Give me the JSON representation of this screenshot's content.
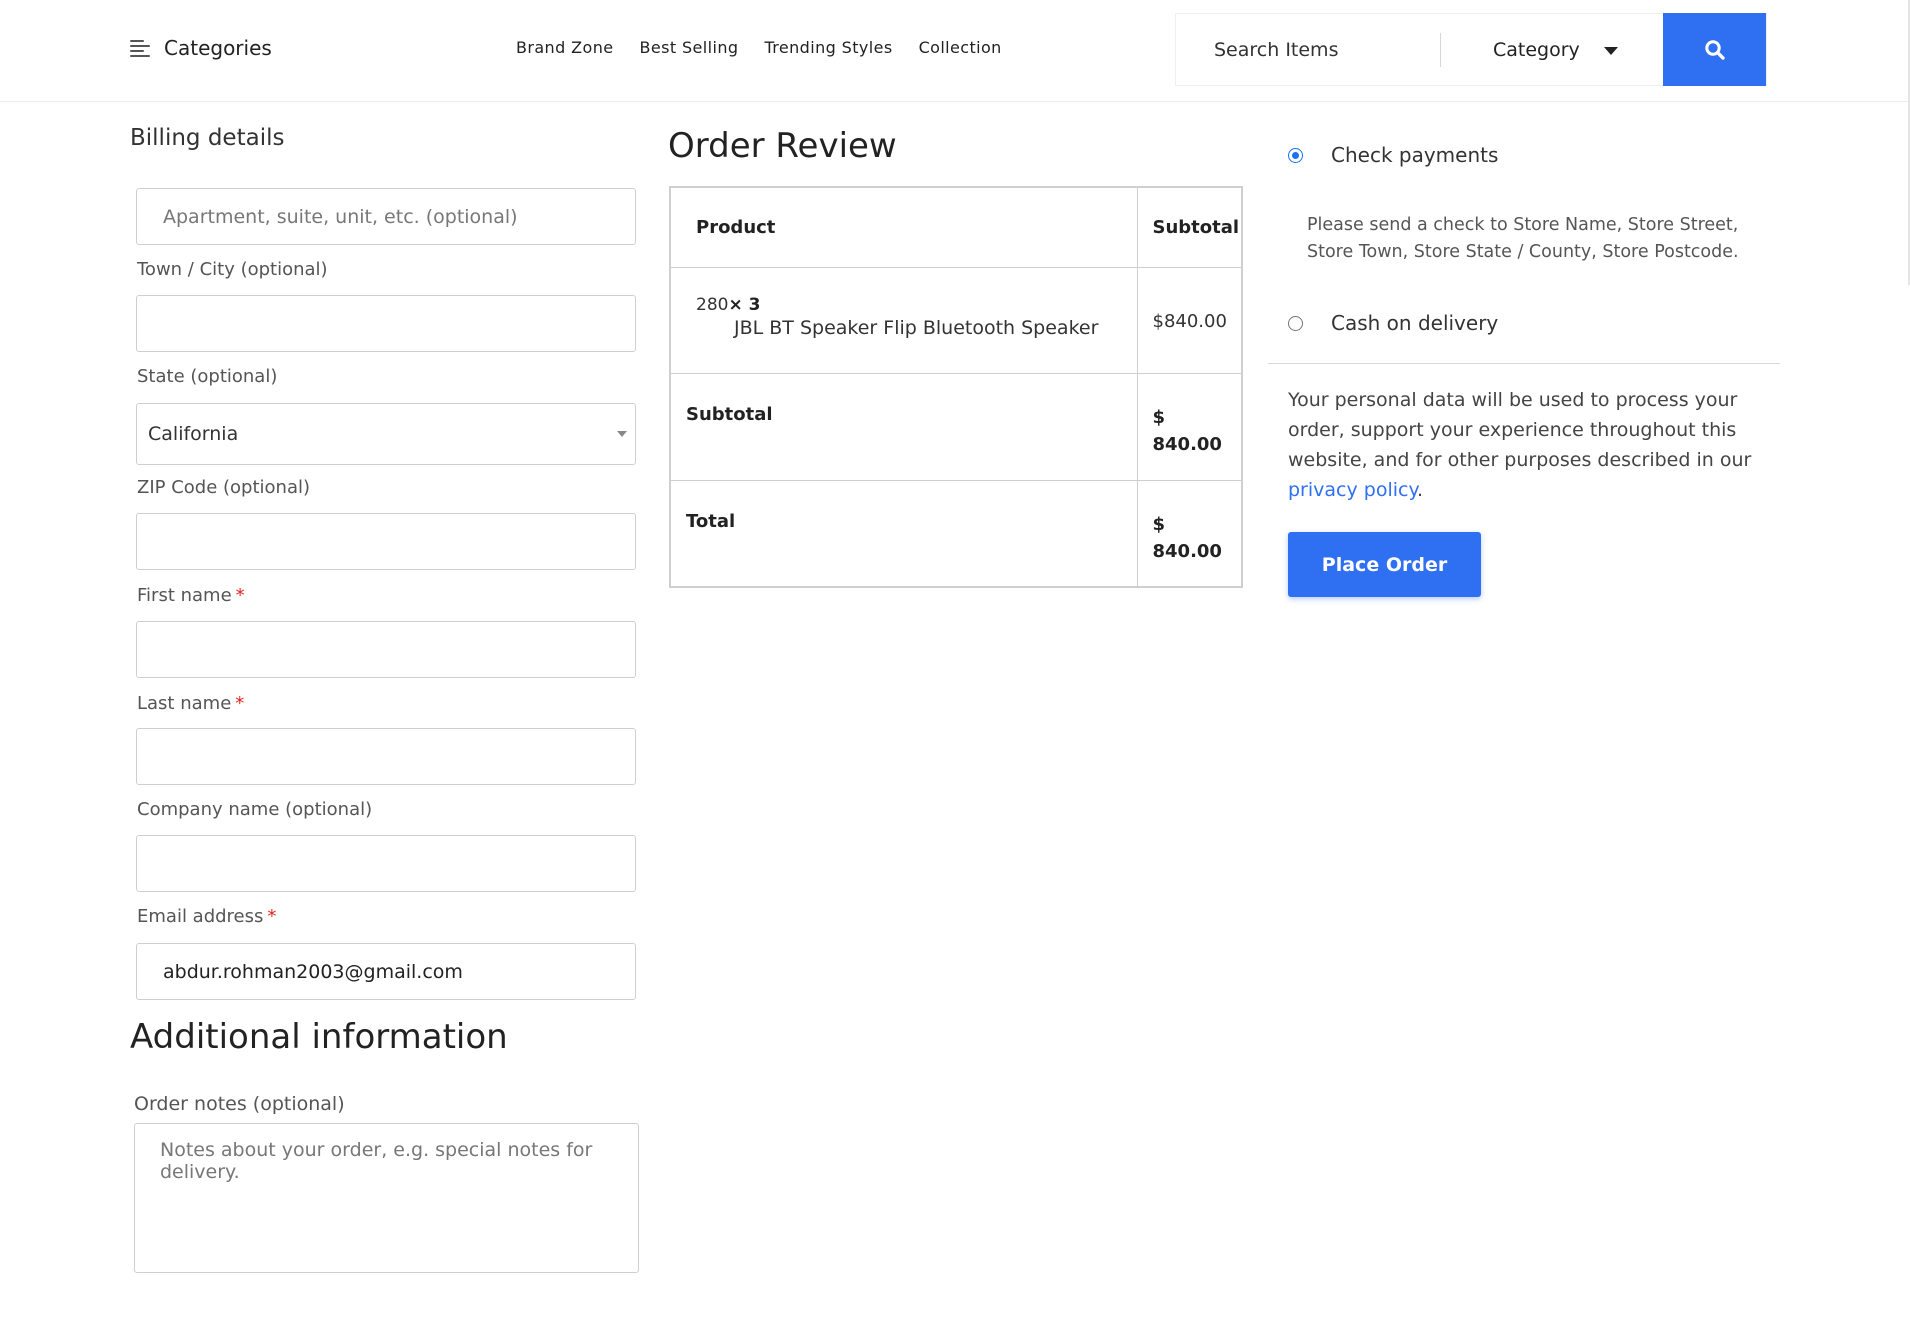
{
  "header": {
    "categories_label": "Categories",
    "nav": [
      "Brand Zone",
      "Best Selling",
      "Trending Styles",
      "Collection"
    ],
    "search_placeholder": "Search Items",
    "category_dropdown": "Category"
  },
  "billing": {
    "title": "Billing details",
    "apartment_placeholder": "Apartment, suite, unit, etc. (optional)",
    "town_label": "Town / City (optional)",
    "state_label": "State (optional)",
    "state_value": "California",
    "zip_label": "ZIP Code (optional)",
    "first_name_label": "First name",
    "last_name_label": "Last name",
    "company_label": "Company name (optional)",
    "email_label": "Email address",
    "email_value": "abdur.rohman2003@gmail.com",
    "required_mark": "*"
  },
  "additional": {
    "title": "Additional information",
    "notes_label": "Order notes (optional)",
    "notes_placeholder": "Notes about your order, e.g. special notes for delivery."
  },
  "order_review": {
    "title": "Order Review",
    "col_product": "Product",
    "col_subtotal": "Subtotal",
    "item_qty_prefix": "280",
    "item_qty": "× 3",
    "item_name": "JBL BT Speaker Flip Bluetooth Speaker",
    "item_price": "$840.00",
    "subtotal_label": "Subtotal",
    "subtotal_currency": "$",
    "subtotal_value": "840.00",
    "total_label": "Total",
    "total_currency": "$",
    "total_value": "840.00"
  },
  "payment": {
    "check_label": "Check payments",
    "check_description": "Please send a check to Store Name, Store Street, Store Town, Store State / County, Store Postcode.",
    "cod_label": "Cash on delivery",
    "privacy_text": "Your personal data will be used to process your order, support your experience throughout this website, and for other purposes described in our ",
    "privacy_link": "privacy policy",
    "privacy_end": ".",
    "place_order": "Place Order"
  },
  "colors": {
    "accent": "#2f6ff2",
    "required": "#e2231a",
    "radio_checked": "#1a73e8"
  },
  "icons": [
    "menu-icon",
    "caret-down-icon",
    "search-icon",
    "select-arrow-icon"
  ]
}
